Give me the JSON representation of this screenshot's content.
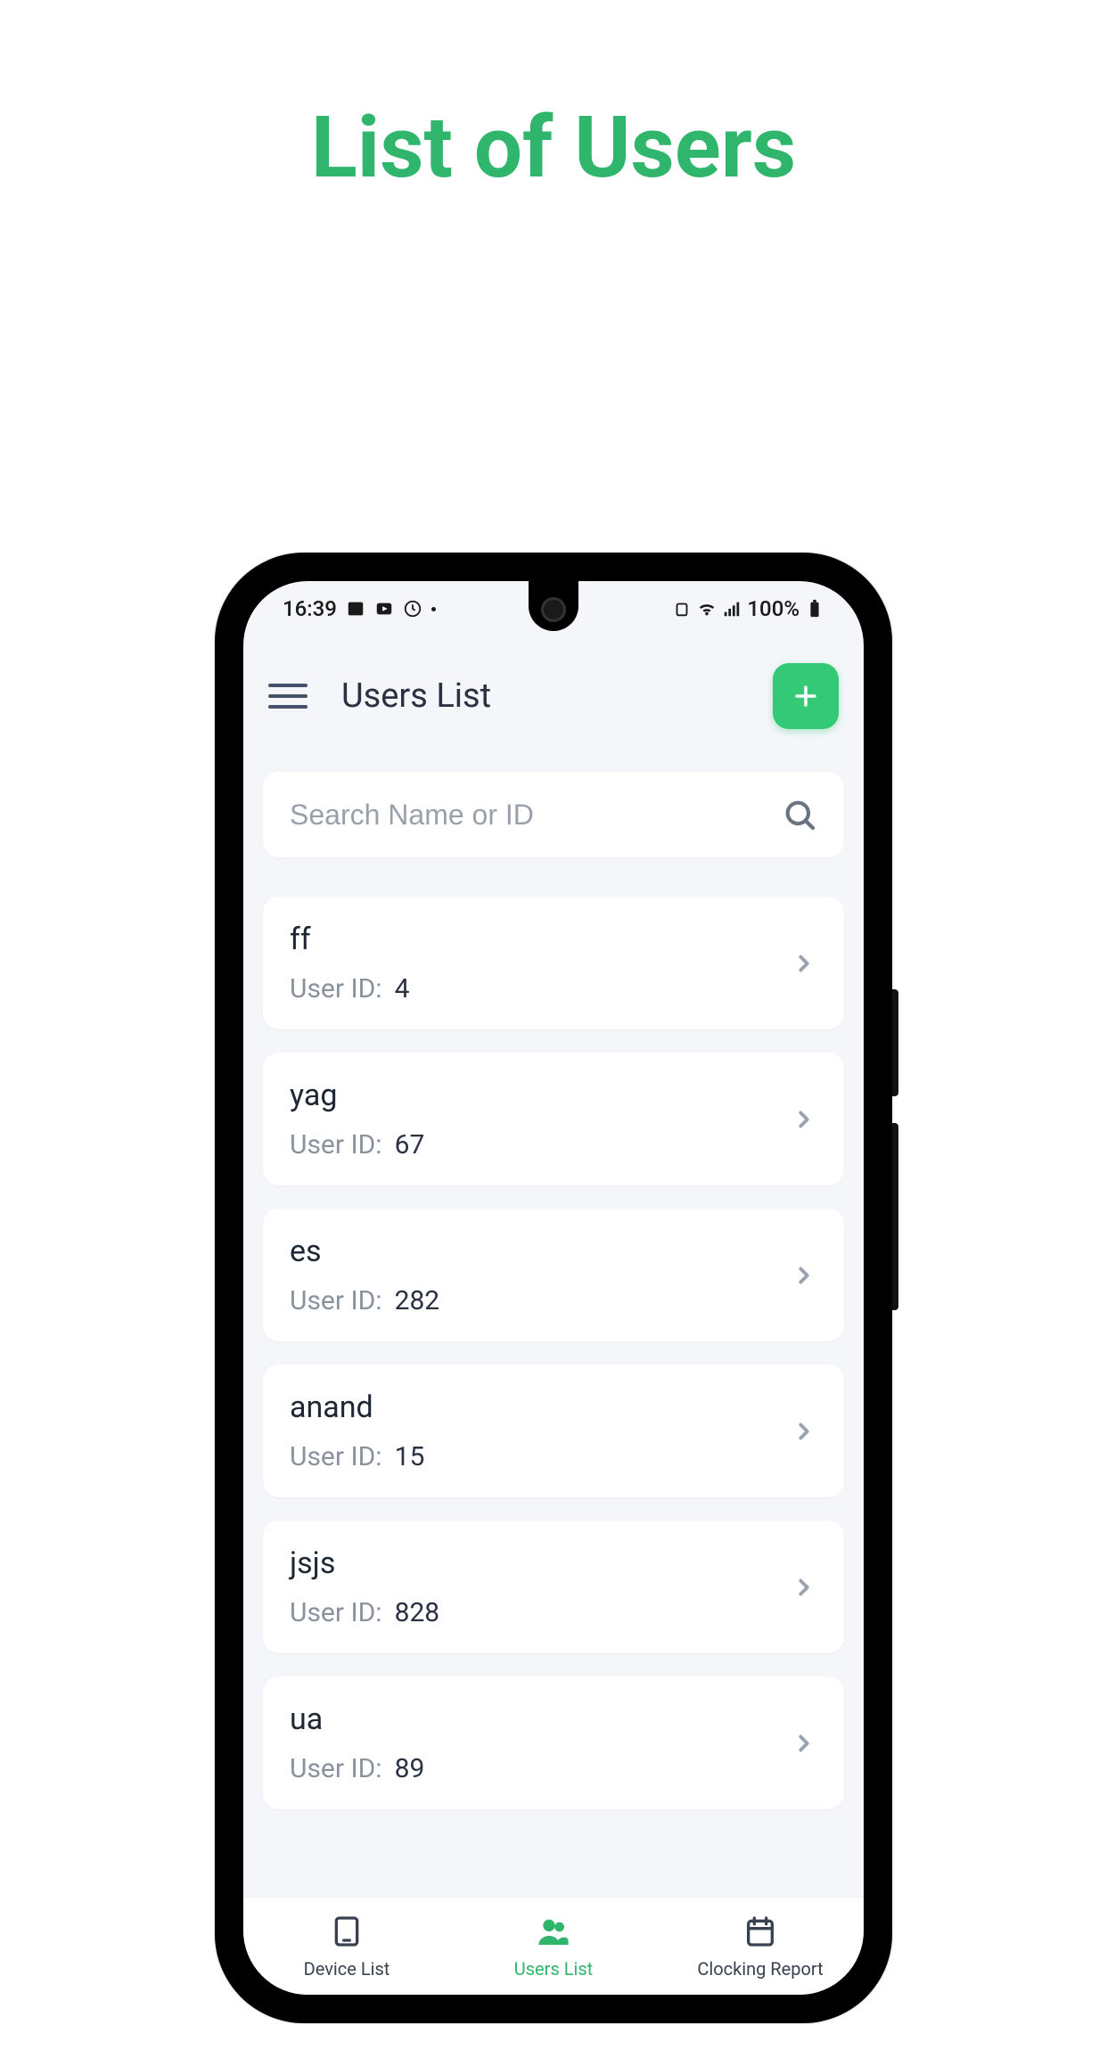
{
  "page_title": "List of Users",
  "status_bar": {
    "time": "16:39",
    "battery_text": "100%"
  },
  "header": {
    "title": "Users List"
  },
  "search": {
    "placeholder": "Search Name or ID",
    "value": ""
  },
  "user_id_label": "User ID:",
  "users": [
    {
      "name": "ff",
      "id": "4"
    },
    {
      "name": "yag",
      "id": "67"
    },
    {
      "name": "es",
      "id": "282"
    },
    {
      "name": "anand",
      "id": "15"
    },
    {
      "name": "jsjs",
      "id": "828"
    },
    {
      "name": "ua",
      "id": "89"
    }
  ],
  "bottom_nav": {
    "items": [
      {
        "label": "Device List",
        "icon": "tablet-icon",
        "active": false
      },
      {
        "label": "Users List",
        "icon": "users-icon",
        "active": true
      },
      {
        "label": "Clocking Report",
        "icon": "calendar-icon",
        "active": false
      }
    ]
  },
  "colors": {
    "accent": "#2fb66c",
    "add_button": "#34c977"
  }
}
